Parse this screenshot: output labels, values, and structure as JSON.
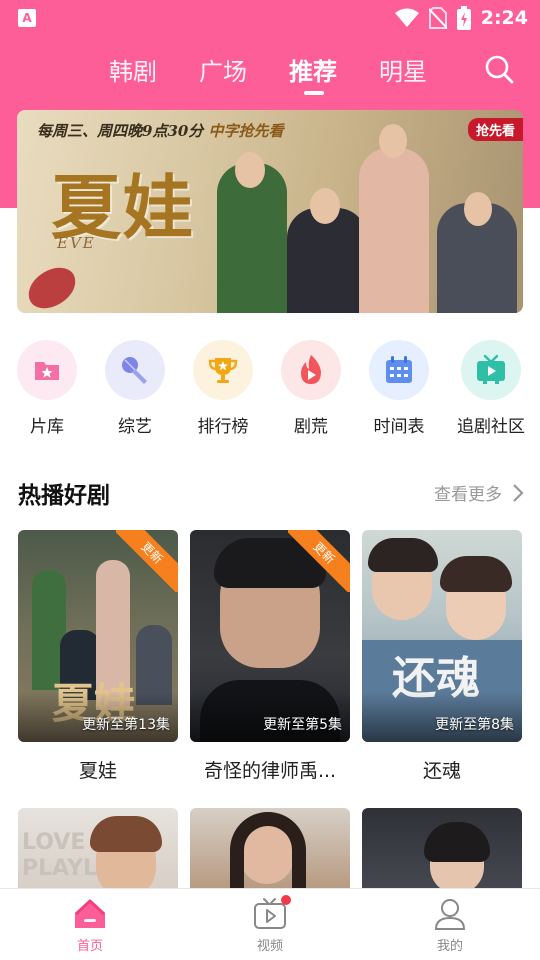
{
  "status_bar": {
    "time": "2:24",
    "app_icon_letter": "A"
  },
  "top_nav": {
    "tabs": [
      {
        "label": "韩剧",
        "active": false
      },
      {
        "label": "广场",
        "active": false
      },
      {
        "label": "推荐",
        "active": true
      },
      {
        "label": "明星",
        "active": false
      }
    ]
  },
  "banner": {
    "subtitle_prefix": "每周三、周四晚9点30分",
    "subtitle_highlight": "中字抢先看",
    "badge": "抢先看",
    "title": "夏娃",
    "title_en": "EVE"
  },
  "categories": [
    {
      "label": "片库",
      "icon": "film-library-icon",
      "bg": "#fde9f1",
      "fg": "#f46fa5"
    },
    {
      "label": "综艺",
      "icon": "microphone-icon",
      "bg": "#e9ebfb",
      "fg": "#7d86e6"
    },
    {
      "label": "排行榜",
      "icon": "trophy-icon",
      "bg": "#fdf2de",
      "fg": "#f2a816"
    },
    {
      "label": "剧荒",
      "icon": "flame-icon",
      "bg": "#fde6e6",
      "fg": "#f2555b"
    },
    {
      "label": "时间表",
      "icon": "calendar-icon",
      "bg": "#e6efff",
      "fg": "#5e8ff0"
    },
    {
      "label": "追剧社区",
      "icon": "tv-icon",
      "bg": "#dcf5f1",
      "fg": "#2fbfa6"
    }
  ],
  "section": {
    "title": "热播好剧",
    "more": "查看更多"
  },
  "shows": [
    {
      "title": "夏娃",
      "caption": "更新至第13集",
      "ribbon": "更新",
      "poster_text": "夏娃"
    },
    {
      "title": "奇怪的律师禹...",
      "caption": "更新至第5集",
      "ribbon": "更新",
      "poster_text": ""
    },
    {
      "title": "还魂",
      "caption": "更新至第8集",
      "ribbon": "",
      "poster_text": "还魂"
    }
  ],
  "second_row": {
    "poster1_text": "LOVE PLAYL"
  },
  "bottom_nav": [
    {
      "label": "首页",
      "icon": "home-icon",
      "active": true
    },
    {
      "label": "视频",
      "icon": "video-icon",
      "active": false,
      "dot": true
    },
    {
      "label": "我的",
      "icon": "profile-icon",
      "active": false
    }
  ],
  "colors": {
    "brand_pink": "#fd5e97",
    "ribbon_orange": "#f7801e",
    "badge_red": "#c7192b"
  }
}
